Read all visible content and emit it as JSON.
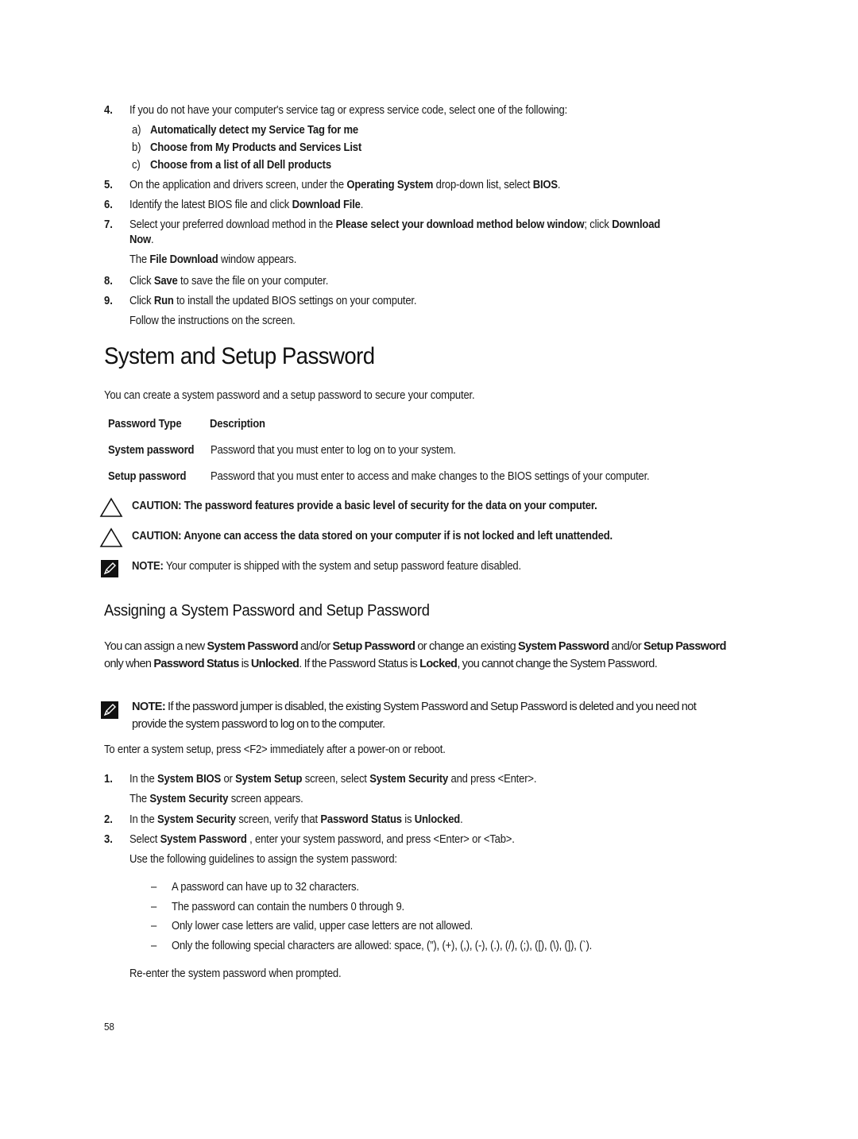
{
  "steps_top": [
    {
      "num": "4.",
      "parts": [
        {
          "t": "If you do not have your computer's service tag or express service code, select one of the following:",
          "b": false
        }
      ],
      "subitems": [
        {
          "letter": "a)",
          "text": "Automatically detect my Service Tag for me"
        },
        {
          "letter": "b)",
          "text": "Choose from My Products and Services List"
        },
        {
          "letter": "c)",
          "text": "Choose from a list of all Dell products"
        }
      ]
    },
    {
      "num": "5.",
      "parts": [
        {
          "t": "On the application and drivers screen, under the ",
          "b": false
        },
        {
          "t": "Operating System",
          "b": true
        },
        {
          "t": " drop-down list, select ",
          "b": false
        },
        {
          "t": "BIOS",
          "b": true
        },
        {
          "t": ".",
          "b": false
        }
      ]
    },
    {
      "num": "6.",
      "parts": [
        {
          "t": "Identify the latest BIOS file and click ",
          "b": false
        },
        {
          "t": "Download File",
          "b": true
        },
        {
          "t": ".",
          "b": false
        }
      ]
    },
    {
      "num": "7.",
      "parts": [
        {
          "t": "Select your preferred download method in the ",
          "b": false
        },
        {
          "t": "Please select your download method below window",
          "b": true
        },
        {
          "t": "; click ",
          "b": false
        },
        {
          "t": "Download",
          "b": true
        }
      ],
      "line2": [
        {
          "t": "Now",
          "b": true
        },
        {
          "t": ".",
          "b": false
        }
      ],
      "after": [
        {
          "t": "The ",
          "b": false
        },
        {
          "t": "File Download",
          "b": true
        },
        {
          "t": " window appears.",
          "b": false
        }
      ]
    },
    {
      "num": "8.",
      "parts": [
        {
          "t": "Click ",
          "b": false
        },
        {
          "t": "Save",
          "b": true
        },
        {
          "t": " to save the file on your computer.",
          "b": false
        }
      ]
    },
    {
      "num": "9.",
      "parts": [
        {
          "t": "Click ",
          "b": false
        },
        {
          "t": "Run",
          "b": true
        },
        {
          "t": " to install the updated BIOS settings on your computer.",
          "b": false
        }
      ],
      "after": [
        {
          "t": "Follow the instructions on the screen.",
          "b": false
        }
      ]
    }
  ],
  "section1": {
    "title": "System and Setup Password",
    "intro": "You can create a system password and a setup password to secure your computer.",
    "table": {
      "headers": [
        "Password Type",
        "Description"
      ],
      "rows": [
        {
          "type": "System password",
          "desc": "Password that you must enter to log on to your system."
        },
        {
          "type": "Setup password",
          "desc": "Password that you must enter to access and make changes to the BIOS settings of your computer."
        }
      ]
    },
    "cautions": [
      "CAUTION: The password features provide a basic level of security for the data on your computer.",
      "CAUTION: Anyone can access the data stored on your computer if is not locked and left unattended."
    ],
    "note": {
      "label": "NOTE:",
      "text": " Your computer is shipped with the system and setup password feature disabled."
    }
  },
  "section2": {
    "title": "Assigning a System Password and Setup Password",
    "para": [
      {
        "t": "You can assign a new ",
        "b": false
      },
      {
        "t": "System Password",
        "b": true
      },
      {
        "t": " and/or ",
        "b": false
      },
      {
        "t": "Setup Password",
        "b": true
      },
      {
        "t": " or change an existing ",
        "b": false
      },
      {
        "t": "System Password",
        "b": true
      },
      {
        "t": " and/or ",
        "b": false
      },
      {
        "t": "Setup Password",
        "b": true
      },
      {
        "t": " only when ",
        "b": false
      },
      {
        "t": "Password Status",
        "b": true
      },
      {
        "t": " is ",
        "b": false
      },
      {
        "t": "Unlocked",
        "b": true
      },
      {
        "t": ". If the Password Status is ",
        "b": false
      },
      {
        "t": "Locked",
        "b": true
      },
      {
        "t": ", you cannot change the System Password.",
        "b": false
      }
    ],
    "note": {
      "label": "NOTE:",
      "text": " If the password jumper is disabled, the existing System Password and Setup Password is deleted and you need not provide the system password to log on to the computer."
    },
    "enter_setup": "To enter a system setup, press <F2> immediately after a power-on or reboot.",
    "steps": [
      {
        "num": "1.",
        "parts": [
          {
            "t": "In the ",
            "b": false
          },
          {
            "t": "System BIOS",
            "b": true
          },
          {
            "t": " or ",
            "b": false
          },
          {
            "t": "System Setup",
            "b": true
          },
          {
            "t": " screen, select ",
            "b": false
          },
          {
            "t": "System Security",
            "b": true
          },
          {
            "t": " and press <Enter>.",
            "b": false
          }
        ],
        "after": [
          {
            "t": "The ",
            "b": false
          },
          {
            "t": "System Security",
            "b": true
          },
          {
            "t": " screen appears.",
            "b": false
          }
        ]
      },
      {
        "num": "2.",
        "parts": [
          {
            "t": "In the ",
            "b": false
          },
          {
            "t": "System Security",
            "b": true
          },
          {
            "t": " screen, verify that ",
            "b": false
          },
          {
            "t": "Password Status",
            "b": true
          },
          {
            "t": " is ",
            "b": false
          },
          {
            "t": "Unlocked",
            "b": true
          },
          {
            "t": ".",
            "b": false
          }
        ]
      },
      {
        "num": "3.",
        "parts": [
          {
            "t": "Select ",
            "b": false
          },
          {
            "t": "System Password",
            "b": true
          },
          {
            "t": " , enter your system password, and press <Enter> or <Tab>.",
            "b": false
          }
        ],
        "after": [
          {
            "t": "Use the following guidelines to assign the system password:",
            "b": false
          }
        ]
      }
    ],
    "guidelines": [
      "A password can have up to 32 characters.",
      "The password can contain the numbers 0 through 9.",
      "Only lower case letters are valid, upper case letters are not allowed.",
      "Only the following special characters are allowed: space, (”), (+), (,), (-), (.), (/), (;), ([), (\\), (]), (`)."
    ],
    "reenter": "Re-enter the system password when prompted."
  },
  "footer": {
    "page_number": "58"
  },
  "icons": {
    "caution": "caution-triangle-icon",
    "note": "note-pencil-icon"
  }
}
